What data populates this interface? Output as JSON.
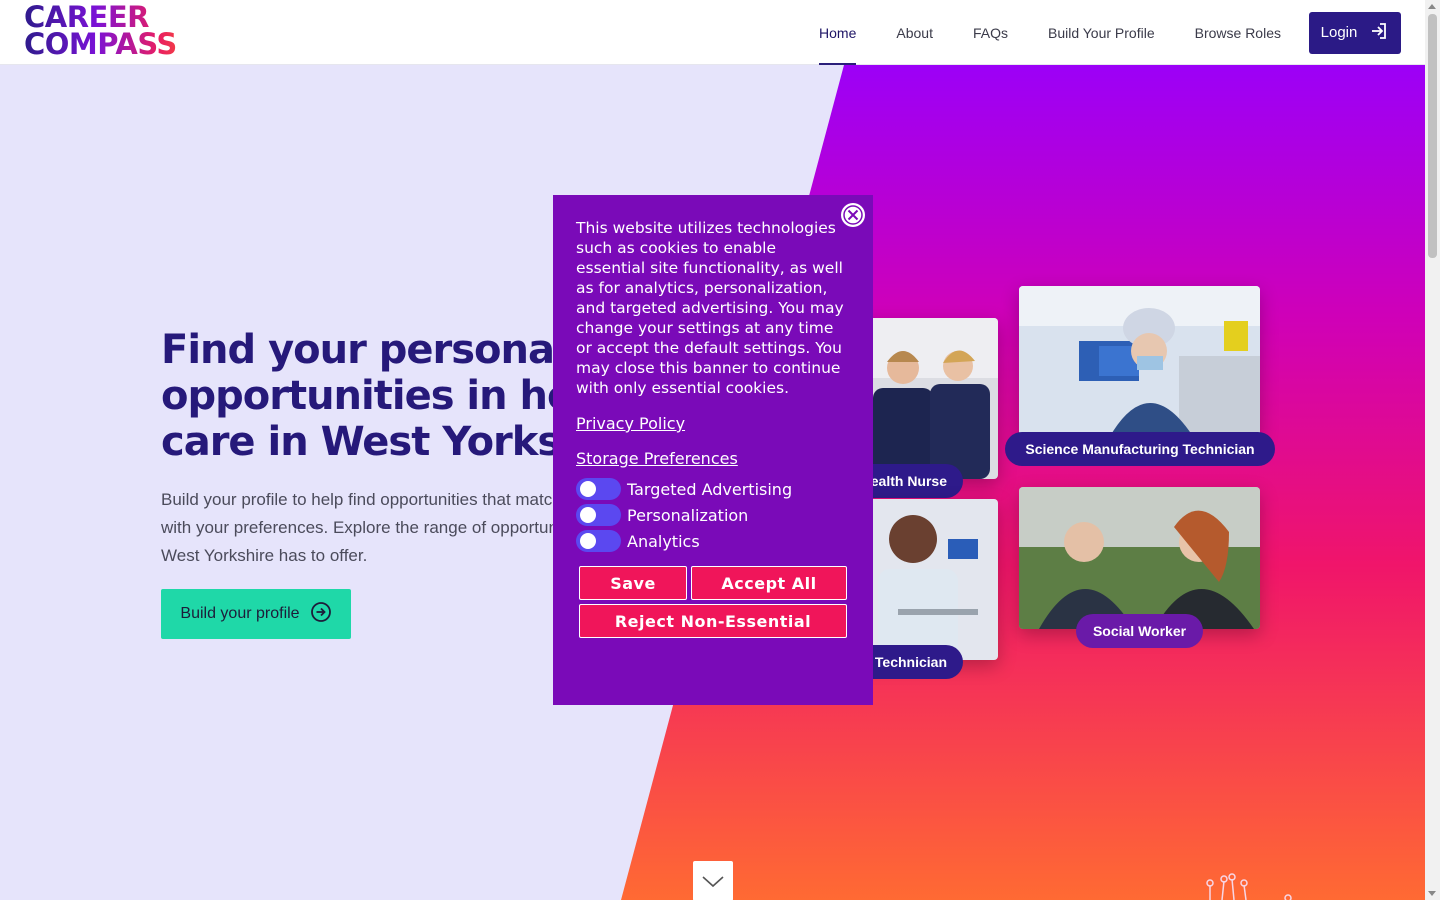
{
  "header": {
    "logo_line1": "CAREER",
    "logo_line2": "COMPASS",
    "nav": [
      {
        "label": "Home",
        "active": true
      },
      {
        "label": "About"
      },
      {
        "label": "FAQs"
      },
      {
        "label": "Build Your Profile"
      },
      {
        "label": "Browse Roles"
      }
    ],
    "login_label": "Login"
  },
  "hero": {
    "title": "Find your personalised opportunities in health and care in West Yorkshire",
    "subtitle": "Build your profile to help find opportunities that match with your preferences. Explore the range of opportunities West Yorkshire has to offer.",
    "cta_label": "Build your profile"
  },
  "roles": [
    {
      "label": "Health Nurse"
    },
    {
      "label": "Science Manufacturing Technician"
    },
    {
      "label": "Technician"
    },
    {
      "label": "Social Worker"
    }
  ],
  "cookie": {
    "text": "This website utilizes technologies such as cookies to enable essential site functionality, as well as for analytics, personalization, and targeted advertising. You may change your settings at any time or accept the default settings. You may close this banner to continue with only essential cookies.",
    "privacy_link": "Privacy Policy",
    "storage_link": "Storage Preferences",
    "prefs": [
      {
        "label": "Targeted Advertising",
        "enabled": false
      },
      {
        "label": "Personalization",
        "enabled": false
      },
      {
        "label": "Analytics",
        "enabled": false
      }
    ],
    "save_label": "Save",
    "accept_label": "Accept All",
    "reject_label": "Reject Non-Essential"
  },
  "colors": {
    "brand_navy": "#2b1a86",
    "cta_green": "#1fd8a8",
    "cookie_purple": "#7a0ab8",
    "cookie_button": "#f0155a"
  }
}
